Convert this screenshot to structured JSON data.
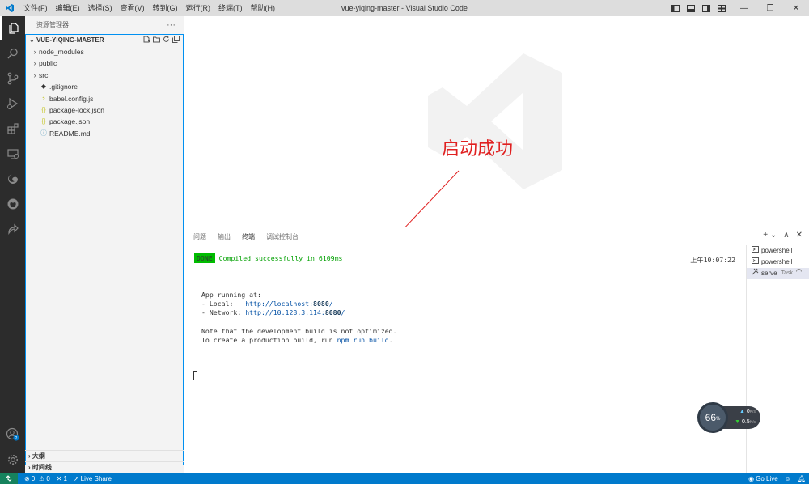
{
  "titlebar": {
    "title": "vue-yiqing-master - Visual Studio Code",
    "menu": [
      "文件(F)",
      "编辑(E)",
      "选择(S)",
      "查看(V)",
      "转到(G)",
      "运行(R)",
      "终端(T)",
      "帮助(H)"
    ],
    "window_controls": [
      "—",
      "❐",
      "✕"
    ]
  },
  "activity_bar": {
    "items": [
      "explorer-icon",
      "search-icon",
      "source-control-icon",
      "run-debug-icon",
      "extensions-icon",
      "remote-explorer-icon",
      "edge-icon",
      "github-icon",
      "live-share-icon"
    ],
    "bottom": [
      "account-icon",
      "gear-icon"
    ],
    "account_badge": "2"
  },
  "sidebar": {
    "title": "资源管理器",
    "more": "···",
    "folder": "VUE-YIQING-MASTER",
    "items": [
      {
        "label": "node_modules",
        "type": "folder"
      },
      {
        "label": "public",
        "type": "folder"
      },
      {
        "label": "src",
        "type": "folder"
      },
      {
        "label": ".gitignore",
        "type": "file",
        "icon": "◆"
      },
      {
        "label": "babel.config.js",
        "type": "file",
        "icon": "⚡"
      },
      {
        "label": "package-lock.json",
        "type": "file",
        "icon": "{}"
      },
      {
        "label": "package.json",
        "type": "file",
        "icon": "{}"
      },
      {
        "label": "README.md",
        "type": "file",
        "icon": "ⓘ"
      }
    ],
    "outline": "大纲",
    "timeline": "时间线"
  },
  "annotation": "启动成功",
  "panel": {
    "tabs": [
      "问题",
      "输出",
      "终端",
      "调试控制台"
    ],
    "active_tab": "终端",
    "tools": [
      "+ ⌄",
      "∧",
      "✕"
    ],
    "terminal": {
      "done_badge": "DONE",
      "compiled": "Compiled successfully in 6109ms",
      "time": "上午10:07:22",
      "app_running": "App running at:",
      "local_label": "- Local:   ",
      "local_url_a": "http://localhost:",
      "local_url_port": "8080",
      "local_url_b": "/",
      "network_label": "- Network: ",
      "network_url_a": "http://10.128.3.114:",
      "network_url_port": "8080",
      "network_url_b": "/",
      "note1": "Note that the development build is not optimized.",
      "note2_a": "To create a production build, run ",
      "note2_cmd": "npm run build",
      "note2_b": "."
    },
    "terminal_list": [
      {
        "label": "powershell",
        "tag": ""
      },
      {
        "label": "powershell",
        "tag": ""
      },
      {
        "label": "serve",
        "tag": "Task"
      }
    ]
  },
  "net_widget": {
    "percent": "66",
    "percent_unit": "%",
    "up": "0",
    "up_unit": "K/s",
    "down": "0.5",
    "down_unit": "K/s"
  },
  "statusbar": {
    "errors": "0",
    "warnings": "0",
    "ports": "1",
    "live_share": "Live Share",
    "go_live": "Go Live"
  },
  "colors": {
    "accent": "#007acc",
    "activity_bg": "#2c2c2c",
    "annotation": "#e02020",
    "done_green": "#00bc00"
  }
}
